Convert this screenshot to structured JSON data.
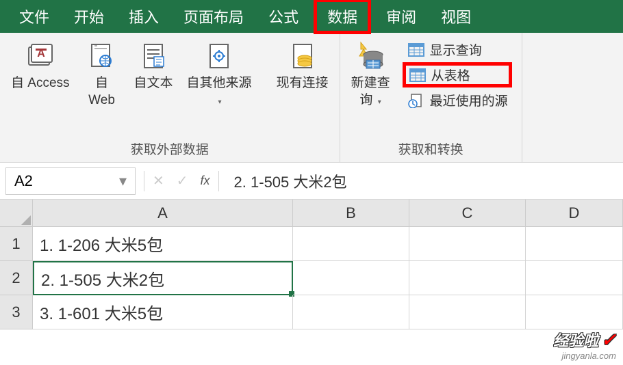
{
  "tabs": {
    "file": "文件",
    "home": "开始",
    "insert": "插入",
    "layout": "页面布局",
    "formula": "公式",
    "data": "数据",
    "review": "审阅",
    "view": "视图"
  },
  "ribbon": {
    "external_group": {
      "label": "获取外部数据",
      "access": "自 Access",
      "web": "自\nWeb",
      "text": "自文本",
      "other": "自其他来源",
      "existing": "现有连接"
    },
    "transform_group": {
      "label": "获取和转换",
      "new_query": "新建查\n询",
      "show_query": "显示查询",
      "from_table": "从表格",
      "recent": "最近使用的源"
    }
  },
  "name_box": "A2",
  "formula_value": "2. 1-505 大米2包",
  "columns": {
    "A": "A",
    "B": "B",
    "C": "C",
    "D": "D"
  },
  "rows": {
    "r1": "1",
    "r2": "2",
    "r3": "3"
  },
  "cells": {
    "A1": "1. 1-206 大米5包",
    "A2": "2. 1-505 大米2包",
    "A3": "3. 1-601 大米5包"
  },
  "watermark": {
    "text": "经验啦",
    "url": "jingyanla.com"
  }
}
